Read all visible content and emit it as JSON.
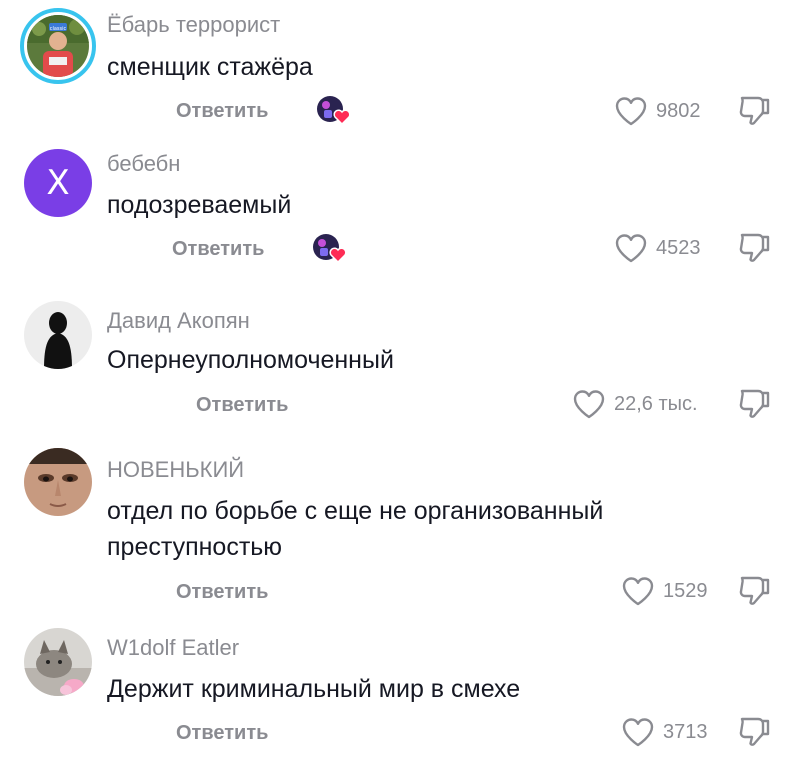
{
  "comments": [
    {
      "username": "Ёбарь террорист",
      "avatar_caption": "classic",
      "text": "сменщик стажёра",
      "reply_label": "Ответить",
      "likes": "9802",
      "liked_by_creator": true
    },
    {
      "username": "бебебн",
      "avatar_letter": "X",
      "text": "подозреваемый",
      "reply_label": "Ответить",
      "likes": "4523",
      "liked_by_creator": true
    },
    {
      "username": "Давид Акопян",
      "text": "Опернеуполномоченный",
      "reply_label": "Ответить",
      "likes": "22,6 тыс.",
      "liked_by_creator": false
    },
    {
      "username": "НОВЕНЬКИЙ",
      "text": "отдел по борьбе с еще не организованный преступностью",
      "reply_label": "Ответить",
      "likes": "1529",
      "liked_by_creator": false
    },
    {
      "username": "W1dolf Eatler",
      "text": "Держит криминальный мир в смехе",
      "reply_label": "Ответить",
      "likes": "3713",
      "liked_by_creator": false
    }
  ],
  "icons": {
    "like": "heart-outline-icon",
    "dislike": "thumbs-down-icon",
    "creator_liked": "creator-liked-badge-icon"
  },
  "colors": {
    "muted_text": "#8a8b91",
    "primary_text": "#161823",
    "story_ring": "#38c4ee",
    "letter_avatar_bg": "#7a3ee6",
    "creator_heart": "#fe2c55"
  }
}
